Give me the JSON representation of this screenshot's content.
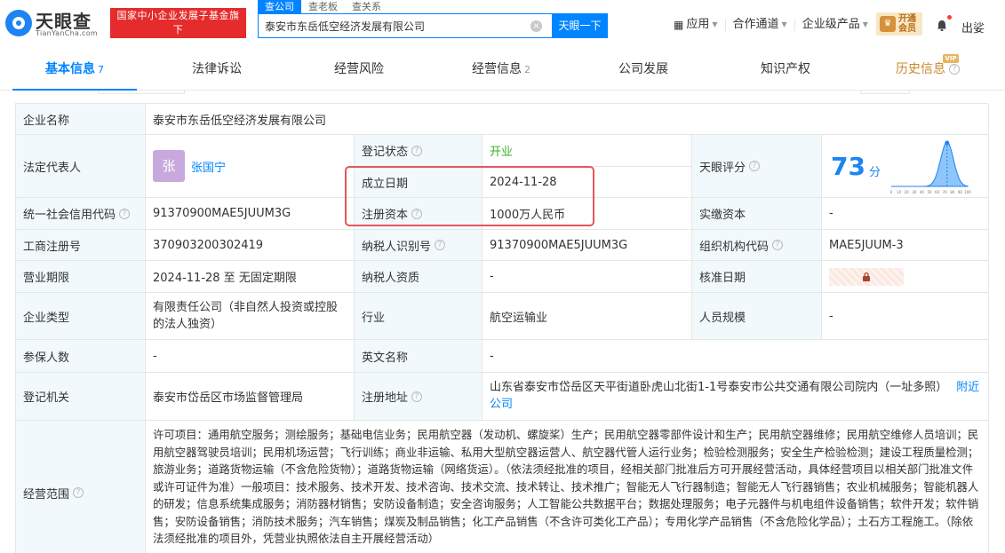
{
  "header": {
    "logo_text": "天眼查",
    "logo_sub": "TianYanCha.com",
    "badge_line1": "国家中小企业发展子基金旗下",
    "badge_line2": "官方备案企业征信机构",
    "search_tabs": [
      "查公司",
      "查老板",
      "查关系"
    ],
    "search_value": "泰安市东岳低空经济发展有限公司",
    "search_button": "天眼一下",
    "nav": [
      "应用",
      "合作通道",
      "企业级产品"
    ],
    "vip_line1": "开通",
    "vip_line2": "会员",
    "user": "出娑"
  },
  "tabs": [
    {
      "label": "基本信息",
      "count": "7"
    },
    {
      "label": "法律诉讼",
      "count": ""
    },
    {
      "label": "经营风险",
      "count": ""
    },
    {
      "label": "经营信息",
      "count": "2"
    },
    {
      "label": "公司发展",
      "count": ""
    },
    {
      "label": "知识产权",
      "count": ""
    },
    {
      "label": "历史信息",
      "count": ""
    }
  ],
  "vip_tag": "VIP",
  "info": {
    "company_name_label": "企业名称",
    "company_name": "泰安市东岳低空经济发展有限公司",
    "legal_rep_label": "法定代表人",
    "legal_rep_avatar": "张",
    "legal_rep": "张国宁",
    "reg_status_label": "登记状态",
    "reg_status": "开业",
    "found_date_label": "成立日期",
    "found_date": "2024-11-28",
    "reg_capital_label": "注册资本",
    "reg_capital": "1000万人民币",
    "score_label": "天眼评分",
    "score": "73",
    "score_unit": "分",
    "paid_capital_label": "实缴资本",
    "paid_capital": "-",
    "credit_code_label": "统一社会信用代码",
    "credit_code": "91370900MAE5JUUM3G",
    "biz_reg_no_label": "工商注册号",
    "biz_reg_no": "370903200302419",
    "taxpayer_id_label": "纳税人识别号",
    "taxpayer_id": "91370900MAE5JUUM3G",
    "org_code_label": "组织机构代码",
    "org_code": "MAE5JUUM-3",
    "term_label": "营业期限",
    "term": "2024-11-28 至 无固定期限",
    "taxpayer_qual_label": "纳税人资质",
    "taxpayer_qual": "-",
    "approve_date_label": "核准日期",
    "company_type_label": "企业类型",
    "company_type": "有限责任公司（非自然人投资或控股的法人独资）",
    "industry_label": "行业",
    "industry": "航空运输业",
    "staff_size_label": "人员规模",
    "staff_size": "-",
    "insured_label": "参保人数",
    "insured": "-",
    "english_name_label": "英文名称",
    "english_name": "-",
    "reg_authority_label": "登记机关",
    "reg_authority": "泰安市岱岳区市场监督管理局",
    "reg_address_label": "注册地址",
    "reg_address": "山东省泰安市岱岳区天平街道卧虎山北街1-1号泰安市公共交通有限公司院内（一址多照）",
    "nearby_label": "附近公司",
    "scope_label": "经营范围",
    "scope": "许可项目：通用航空服务；测绘服务；基础电信业务；民用航空器（发动机、螺旋桨）生产；民用航空器零部件设计和生产；民用航空器维修；民用航空维修人员培训；民用航空器驾驶员培训；民用机场运营；飞行训练；商业非运输、私用大型航空器运营人、航空器代管人运行业务；检验检测服务；安全生产检验检测；建设工程质量检测；旅游业务；道路货物运输（不含危险货物）；道路货物运输（网络货运）。（依法须经批准的项目，经相关部门批准后方可开展经营活动，具体经营项目以相关部门批准文件或许可证件为准）一般项目：技术服务、技术开发、技术咨询、技术交流、技术转让、技术推广；智能无人飞行器制造；智能无人飞行器销售；农业机械服务；智能机器人的研发；信息系统集成服务；消防器材销售；安防设备制造；安全咨询服务；人工智能公共数据平台；数据处理服务；电子元器件与机电组件设备销售；软件开发；软件销售；安防设备销售；消防技术服务；汽车销售；煤炭及制品销售；化工产品销售（不含许可类化工产品）；专用化学产品销售（不含危险化学品）；土石方工程施工。（除依法须经批准的项目外，凭营业执照依法自主开展经营活动）"
  },
  "chart_data": {
    "type": "area",
    "title": "",
    "x_ticks": [
      "0",
      "10",
      "20",
      "30",
      "40",
      "50",
      "60",
      "70",
      "80",
      "90",
      "100"
    ],
    "marker_value": 73,
    "colors": {
      "fill": "#8ec5fb",
      "line": "#1e83f3"
    }
  }
}
